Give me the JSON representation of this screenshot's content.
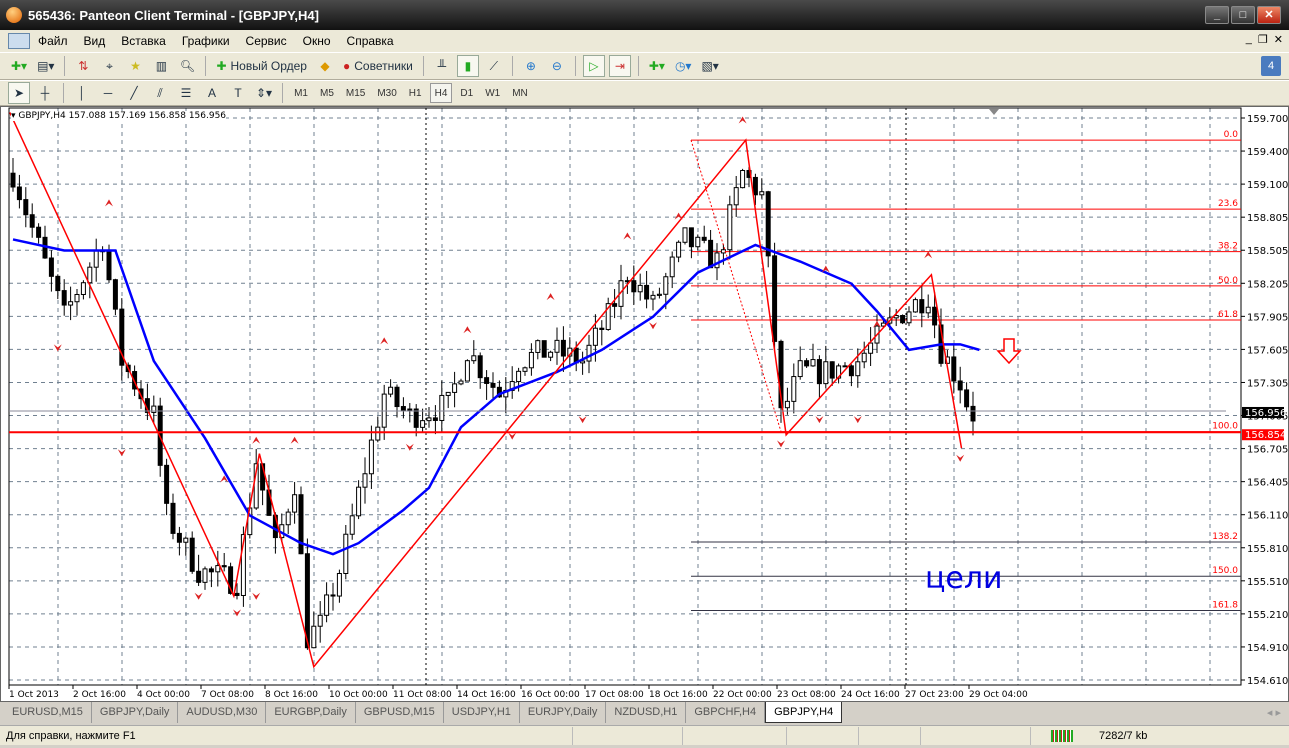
{
  "window": {
    "title": "565436: Panteon Client Terminal - [GBPJPY,H4]",
    "min": "_",
    "max": "□",
    "close": "✕"
  },
  "menu": [
    "Файл",
    "Вид",
    "Вставка",
    "Графики",
    "Сервис",
    "Окно",
    "Справка"
  ],
  "toolbar": {
    "new_order": "Новый Ордер",
    "experts": "Советники",
    "badge": "4"
  },
  "timeframes": [
    "M1",
    "M5",
    "M15",
    "M30",
    "H1",
    "H4",
    "D1",
    "W1",
    "MN"
  ],
  "active_timeframe": "H4",
  "chart_header": "GBPJPY,H4  157.088 157.169 156.858 156.956",
  "annotation": "цели",
  "tabs": [
    "EURUSD,M15",
    "GBPJPY,Daily",
    "AUDUSD,M30",
    "EURGBP,Daily",
    "GBPUSD,M15",
    "USDJPY,H1",
    "EURJPY,Daily",
    "NZDUSD,H1",
    "GBPCHF,H4",
    "GBPJPY,H4"
  ],
  "active_tab": "GBPJPY,H4",
  "status": {
    "help": "Для справки, нажмите F1",
    "traffic": "7282/7 kb"
  },
  "colors": {
    "bull": "#ffffff",
    "bear": "#000000",
    "ma": "#0000ff",
    "lines": "#ff0000",
    "bid_label": "#000000",
    "ask_label": "#ff0000"
  },
  "chart_data": {
    "type": "candlestick",
    "symbol": "GBPJPY",
    "timeframe": "H4",
    "ohlc_last": {
      "open": 157.088,
      "high": 157.169,
      "low": 156.858,
      "close": 156.956
    },
    "ylim": [
      154.61,
      159.7
    ],
    "y_ticks": [
      "159.700",
      "159.400",
      "159.100",
      "158.805",
      "158.505",
      "158.205",
      "157.905",
      "157.605",
      "157.305",
      "157.005",
      "156.705",
      "156.405",
      "156.110",
      "155.810",
      "155.510",
      "155.210",
      "154.910",
      "154.610"
    ],
    "x_ticks": [
      "1 Oct 2013",
      "2 Oct 16:00",
      "4 Oct 00:00",
      "7 Oct 08:00",
      "8 Oct 16:00",
      "10 Oct 00:00",
      "11 Oct 08:00",
      "14 Oct 16:00",
      "16 Oct 00:00",
      "17 Oct 08:00",
      "18 Oct 16:00",
      "22 Oct 00:00",
      "23 Oct 08:00",
      "24 Oct 16:00",
      "27 Oct 23:00",
      "29 Oct 04:00"
    ],
    "price_path": [
      [
        0,
        159.2
      ],
      [
        3,
        158.7
      ],
      [
        8,
        157.9
      ],
      [
        14,
        158.6
      ],
      [
        17,
        157.5
      ],
      [
        22,
        157.0
      ],
      [
        24,
        156.1
      ],
      [
        29,
        155.6
      ],
      [
        35,
        155.5
      ],
      [
        38,
        156.6
      ],
      [
        41,
        155.8
      ],
      [
        44,
        156.4
      ],
      [
        46,
        155.0
      ],
      [
        48,
        155.1
      ],
      [
        51,
        155.6
      ],
      [
        54,
        156.3
      ],
      [
        58,
        157.2
      ],
      [
        62,
        157.0
      ],
      [
        68,
        157.1
      ],
      [
        71,
        157.6
      ],
      [
        76,
        157.2
      ],
      [
        79,
        157.5
      ],
      [
        84,
        157.6
      ],
      [
        89,
        157.5
      ],
      [
        93,
        157.9
      ],
      [
        96,
        158.3
      ],
      [
        100,
        158.0
      ],
      [
        105,
        158.6
      ],
      [
        110,
        158.4
      ],
      [
        114,
        159.2
      ],
      [
        117,
        159.0
      ],
      [
        119,
        157.7
      ],
      [
        120,
        157.0
      ],
      [
        123,
        157.4
      ],
      [
        127,
        157.4
      ],
      [
        132,
        157.5
      ],
      [
        138,
        157.9
      ],
      [
        143,
        158.1
      ],
      [
        145,
        157.6
      ],
      [
        148,
        157.3
      ],
      [
        150,
        156.96
      ]
    ],
    "ma_path": [
      [
        0,
        158.6
      ],
      [
        8,
        158.5
      ],
      [
        16,
        158.5
      ],
      [
        22,
        157.5
      ],
      [
        30,
        156.8
      ],
      [
        37,
        156.1
      ],
      [
        45,
        155.85
      ],
      [
        50,
        155.75
      ],
      [
        54,
        155.85
      ],
      [
        61,
        156.15
      ],
      [
        65,
        156.35
      ],
      [
        70,
        156.9
      ],
      [
        76,
        157.2
      ],
      [
        85,
        157.4
      ],
      [
        92,
        157.6
      ],
      [
        100,
        157.9
      ],
      [
        107,
        158.3
      ],
      [
        116,
        158.55
      ],
      [
        123,
        158.4
      ],
      [
        131,
        158.2
      ],
      [
        135,
        157.95
      ],
      [
        140,
        157.6
      ],
      [
        145,
        157.65
      ],
      [
        148,
        157.65
      ],
      [
        151,
        157.6
      ]
    ],
    "zigzag": [
      [
        -0.5,
        159.75
      ],
      [
        34.5,
        155.37
      ],
      [
        38.5,
        156.66
      ],
      [
        47,
        154.73
      ],
      [
        114.5,
        159.5
      ],
      [
        120.8,
        156.83
      ],
      [
        143.5,
        158.28
      ],
      [
        148.2,
        156.71
      ]
    ],
    "horizontal_lines": [
      {
        "price": 156.854,
        "label": "156.854"
      },
      {
        "price": 156.956,
        "label": "156.956"
      }
    ],
    "fibonacci": [
      {
        "level": "0.0",
        "price": 159.5
      },
      {
        "level": "23.6",
        "price": 158.875
      },
      {
        "level": "38.2",
        "price": 158.49
      },
      {
        "level": "50.0",
        "price": 158.18
      },
      {
        "level": "61.8",
        "price": 157.87
      },
      {
        "level": "100.0",
        "price": 156.86
      },
      {
        "level": "138.2",
        "price": 155.86
      },
      {
        "level": "150.0",
        "price": 155.55
      },
      {
        "level": "161.8",
        "price": 155.24
      }
    ],
    "fractals_up": [
      [
        15,
        158.9
      ],
      [
        38,
        156.75
      ],
      [
        33,
        156.4
      ],
      [
        44,
        156.75
      ],
      [
        58,
        157.65
      ],
      [
        71,
        157.75
      ],
      [
        84,
        158.05
      ],
      [
        96,
        158.6
      ],
      [
        104,
        158.78
      ],
      [
        114,
        159.65
      ],
      [
        127,
        158.3
      ],
      [
        143,
        158.43
      ],
      [
        135,
        157.8
      ]
    ],
    "fractals_down": [
      [
        7,
        157.65
      ],
      [
        17,
        156.7
      ],
      [
        29,
        155.4
      ],
      [
        35,
        155.25
      ],
      [
        38,
        155.4
      ],
      [
        62,
        156.75
      ],
      [
        78,
        156.85
      ],
      [
        89,
        157.0
      ],
      [
        100,
        157.85
      ],
      [
        120,
        156.78
      ],
      [
        126,
        157.0
      ],
      [
        132,
        157.0
      ],
      [
        148,
        156.65
      ]
    ]
  }
}
